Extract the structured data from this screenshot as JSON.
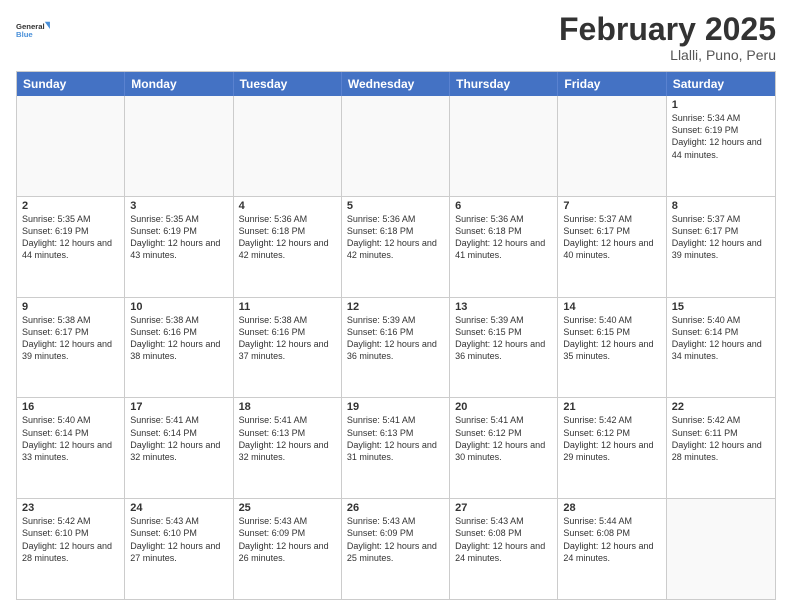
{
  "logo": {
    "line1": "General",
    "line2": "Blue"
  },
  "header": {
    "month": "February 2025",
    "location": "Llalli, Puno, Peru"
  },
  "days_of_week": [
    "Sunday",
    "Monday",
    "Tuesday",
    "Wednesday",
    "Thursday",
    "Friday",
    "Saturday"
  ],
  "weeks": [
    [
      {
        "day": "",
        "text": "",
        "empty": true
      },
      {
        "day": "",
        "text": "",
        "empty": true
      },
      {
        "day": "",
        "text": "",
        "empty": true
      },
      {
        "day": "",
        "text": "",
        "empty": true
      },
      {
        "day": "",
        "text": "",
        "empty": true
      },
      {
        "day": "",
        "text": "",
        "empty": true
      },
      {
        "day": "1",
        "text": "Sunrise: 5:34 AM\nSunset: 6:19 PM\nDaylight: 12 hours and 44 minutes.",
        "empty": false
      }
    ],
    [
      {
        "day": "2",
        "text": "Sunrise: 5:35 AM\nSunset: 6:19 PM\nDaylight: 12 hours and 44 minutes.",
        "empty": false
      },
      {
        "day": "3",
        "text": "Sunrise: 5:35 AM\nSunset: 6:19 PM\nDaylight: 12 hours and 43 minutes.",
        "empty": false
      },
      {
        "day": "4",
        "text": "Sunrise: 5:36 AM\nSunset: 6:18 PM\nDaylight: 12 hours and 42 minutes.",
        "empty": false
      },
      {
        "day": "5",
        "text": "Sunrise: 5:36 AM\nSunset: 6:18 PM\nDaylight: 12 hours and 42 minutes.",
        "empty": false
      },
      {
        "day": "6",
        "text": "Sunrise: 5:36 AM\nSunset: 6:18 PM\nDaylight: 12 hours and 41 minutes.",
        "empty": false
      },
      {
        "day": "7",
        "text": "Sunrise: 5:37 AM\nSunset: 6:17 PM\nDaylight: 12 hours and 40 minutes.",
        "empty": false
      },
      {
        "day": "8",
        "text": "Sunrise: 5:37 AM\nSunset: 6:17 PM\nDaylight: 12 hours and 39 minutes.",
        "empty": false
      }
    ],
    [
      {
        "day": "9",
        "text": "Sunrise: 5:38 AM\nSunset: 6:17 PM\nDaylight: 12 hours and 39 minutes.",
        "empty": false
      },
      {
        "day": "10",
        "text": "Sunrise: 5:38 AM\nSunset: 6:16 PM\nDaylight: 12 hours and 38 minutes.",
        "empty": false
      },
      {
        "day": "11",
        "text": "Sunrise: 5:38 AM\nSunset: 6:16 PM\nDaylight: 12 hours and 37 minutes.",
        "empty": false
      },
      {
        "day": "12",
        "text": "Sunrise: 5:39 AM\nSunset: 6:16 PM\nDaylight: 12 hours and 36 minutes.",
        "empty": false
      },
      {
        "day": "13",
        "text": "Sunrise: 5:39 AM\nSunset: 6:15 PM\nDaylight: 12 hours and 36 minutes.",
        "empty": false
      },
      {
        "day": "14",
        "text": "Sunrise: 5:40 AM\nSunset: 6:15 PM\nDaylight: 12 hours and 35 minutes.",
        "empty": false
      },
      {
        "day": "15",
        "text": "Sunrise: 5:40 AM\nSunset: 6:14 PM\nDaylight: 12 hours and 34 minutes.",
        "empty": false
      }
    ],
    [
      {
        "day": "16",
        "text": "Sunrise: 5:40 AM\nSunset: 6:14 PM\nDaylight: 12 hours and 33 minutes.",
        "empty": false
      },
      {
        "day": "17",
        "text": "Sunrise: 5:41 AM\nSunset: 6:14 PM\nDaylight: 12 hours and 32 minutes.",
        "empty": false
      },
      {
        "day": "18",
        "text": "Sunrise: 5:41 AM\nSunset: 6:13 PM\nDaylight: 12 hours and 32 minutes.",
        "empty": false
      },
      {
        "day": "19",
        "text": "Sunrise: 5:41 AM\nSunset: 6:13 PM\nDaylight: 12 hours and 31 minutes.",
        "empty": false
      },
      {
        "day": "20",
        "text": "Sunrise: 5:41 AM\nSunset: 6:12 PM\nDaylight: 12 hours and 30 minutes.",
        "empty": false
      },
      {
        "day": "21",
        "text": "Sunrise: 5:42 AM\nSunset: 6:12 PM\nDaylight: 12 hours and 29 minutes.",
        "empty": false
      },
      {
        "day": "22",
        "text": "Sunrise: 5:42 AM\nSunset: 6:11 PM\nDaylight: 12 hours and 28 minutes.",
        "empty": false
      }
    ],
    [
      {
        "day": "23",
        "text": "Sunrise: 5:42 AM\nSunset: 6:10 PM\nDaylight: 12 hours and 28 minutes.",
        "empty": false
      },
      {
        "day": "24",
        "text": "Sunrise: 5:43 AM\nSunset: 6:10 PM\nDaylight: 12 hours and 27 minutes.",
        "empty": false
      },
      {
        "day": "25",
        "text": "Sunrise: 5:43 AM\nSunset: 6:09 PM\nDaylight: 12 hours and 26 minutes.",
        "empty": false
      },
      {
        "day": "26",
        "text": "Sunrise: 5:43 AM\nSunset: 6:09 PM\nDaylight: 12 hours and 25 minutes.",
        "empty": false
      },
      {
        "day": "27",
        "text": "Sunrise: 5:43 AM\nSunset: 6:08 PM\nDaylight: 12 hours and 24 minutes.",
        "empty": false
      },
      {
        "day": "28",
        "text": "Sunrise: 5:44 AM\nSunset: 6:08 PM\nDaylight: 12 hours and 24 minutes.",
        "empty": false
      },
      {
        "day": "",
        "text": "",
        "empty": true
      }
    ]
  ]
}
